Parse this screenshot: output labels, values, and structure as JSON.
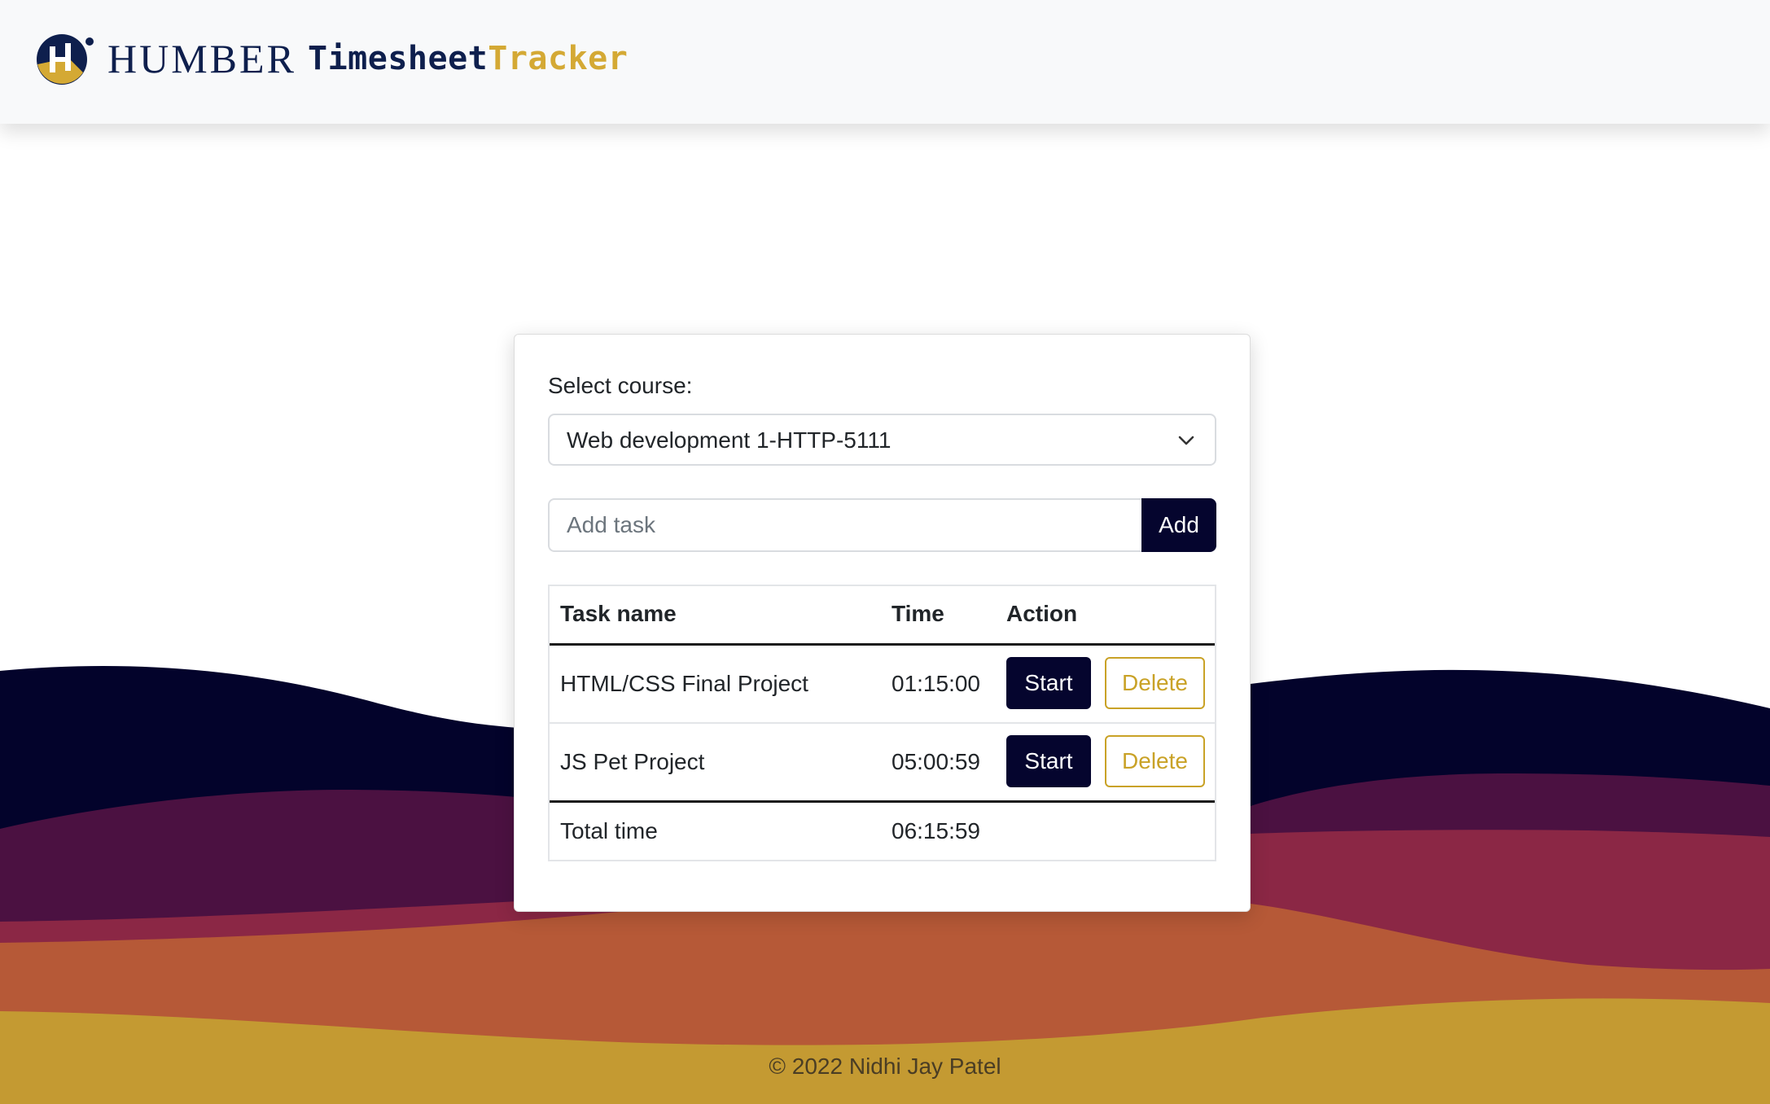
{
  "brand": {
    "institution": "HUMBER",
    "app_name_part1": "Timesheet",
    "app_name_part2": "Tracker",
    "logo_icon": "humber-h-logo-icon"
  },
  "form": {
    "select_label": "Select course:",
    "selected_course": "Web development 1-HTTP-5111",
    "task_placeholder": "Add task",
    "task_value": "",
    "add_label": "Add"
  },
  "table": {
    "headers": [
      "Task name",
      "Time",
      "Action"
    ],
    "rows": [
      {
        "name": "HTML/CSS Final Project",
        "time": "01:15:00",
        "start_label": "Start",
        "delete_label": "Delete"
      },
      {
        "name": "JS Pet Project",
        "time": "05:00:59",
        "start_label": "Start",
        "delete_label": "Delete"
      }
    ],
    "total_label": "Total time",
    "total_time": "06:15:59"
  },
  "footer": {
    "text": "© 2022 Nidhi Jay Patel"
  },
  "colors": {
    "navy": "#05052e",
    "brand_navy": "#0e1f4d",
    "gold": "#c9a227",
    "wave_1": "#03032b",
    "wave_2": "#4b1141",
    "wave_3": "#8b2745",
    "wave_4": "#b65937",
    "wave_5": "#c49a32"
  }
}
